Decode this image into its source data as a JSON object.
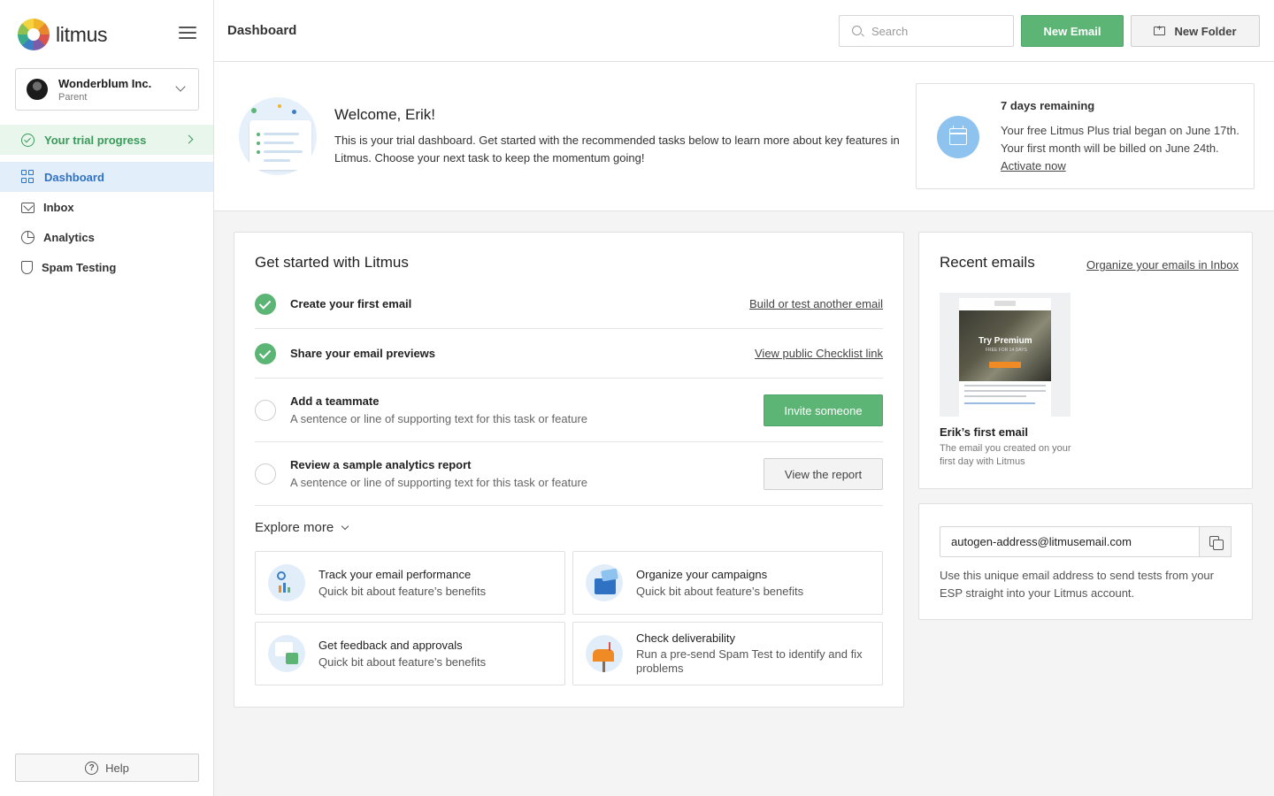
{
  "app": {
    "logo_text": "litmus"
  },
  "account": {
    "name": "Wonderblum Inc.",
    "role": "Parent"
  },
  "sidebar": {
    "trial_progress": "Your trial progress",
    "items": [
      {
        "label": "Dashboard",
        "active": true
      },
      {
        "label": "Inbox"
      },
      {
        "label": "Analytics"
      },
      {
        "label": "Spam Testing"
      }
    ],
    "help_label": "Help"
  },
  "header": {
    "title": "Dashboard",
    "search_placeholder": "Search",
    "new_email_label": "New Email",
    "new_folder_label": "New Folder"
  },
  "welcome": {
    "title": "Welcome, Erik!",
    "body": "This is your trial dashboard. Get started with the recommended tasks below to learn more about key features in Litmus. Choose your next task to keep the momentum going!"
  },
  "trial": {
    "heading": "7 days remaining",
    "body": "Your free Litmus Plus trial began on June 17th. Your first month will be billed on June 24th.",
    "link": "Activate now"
  },
  "get_started": {
    "title": "Get started with Litmus",
    "tasks": [
      {
        "title": "Create your first email",
        "done": true,
        "action": "Build or test another email"
      },
      {
        "title": "Share your email previews",
        "done": true,
        "action": "View public Checklist link"
      },
      {
        "title": "Add a teammate",
        "done": false,
        "subtitle": "A sentence or line of supporting text for this task or feature",
        "action": "Invite someone"
      },
      {
        "title": "Review a sample analytics report",
        "done": false,
        "subtitle": "A sentence or line of supporting text for this task or feature",
        "action": "View the report"
      }
    ],
    "explore_label": "Explore more",
    "features": [
      {
        "title": "Track your email performance",
        "subtitle": "Quick bit about feature’s benefits"
      },
      {
        "title": "Organize your campaigns",
        "subtitle": "Quick bit about feature’s benefits"
      },
      {
        "title": "Get feedback and approvals",
        "subtitle": "Quick bit about feature’s benefits"
      },
      {
        "title": "Check deliverability",
        "subtitle": "Run a pre-send Spam Test to identify and fix problems"
      }
    ]
  },
  "recent": {
    "title": "Recent emails",
    "link": "Organize your emails in Inbox",
    "thumb_title": "Try Premium",
    "thumb_sub": "FREE FOR 14 DAYS",
    "email_name": "Erik’s first email",
    "email_desc": "The email you created on your first day with Litmus"
  },
  "autogen": {
    "address": "autogen-address@litmusemail.com",
    "description": "Use this unique email address to send tests from your ESP straight into your Litmus account."
  },
  "colors": {
    "brand_green": "#5cb575",
    "active_blue": "#2f72c4",
    "trial_green": "#3a9a5b"
  }
}
